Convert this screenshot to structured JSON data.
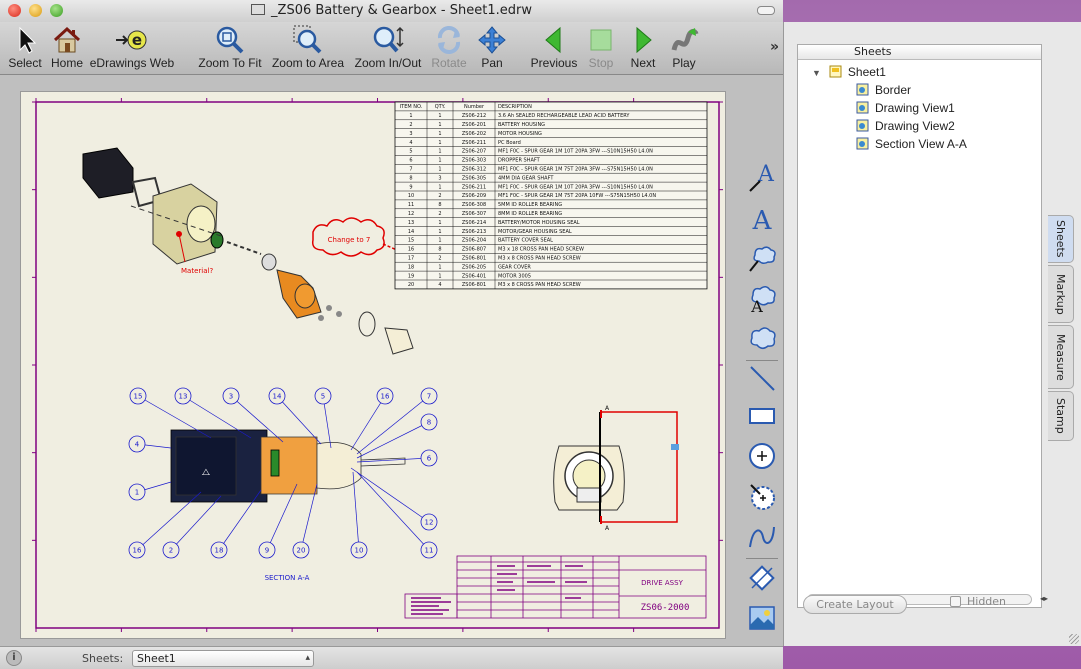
{
  "window": {
    "title": "_ZS06 Battery & Gearbox - Sheet1.edrw"
  },
  "toolbar": {
    "buttons": [
      {
        "id": "select",
        "label": "Select",
        "icon": "cursor-arrow-icon"
      },
      {
        "id": "home",
        "label": "Home",
        "icon": "home-icon"
      },
      {
        "id": "edrawings-web",
        "label": "eDrawings Web",
        "icon": "edrawings-web-icon"
      },
      {
        "id": "zoom-to-fit",
        "label": "Zoom To Fit",
        "icon": "zoom-fit-icon"
      },
      {
        "id": "zoom-to-area",
        "label": "Zoom to Area",
        "icon": "zoom-area-icon"
      },
      {
        "id": "zoom-in-out",
        "label": "Zoom In/Out",
        "icon": "zoom-in-out-icon"
      },
      {
        "id": "rotate",
        "label": "Rotate",
        "icon": "rotate-icon",
        "disabled": true
      },
      {
        "id": "pan",
        "label": "Pan",
        "icon": "pan-icon"
      },
      {
        "id": "previous",
        "label": "Previous",
        "icon": "previous-icon"
      },
      {
        "id": "stop",
        "label": "Stop",
        "icon": "stop-icon",
        "disabled": true
      },
      {
        "id": "next",
        "label": "Next",
        "icon": "next-icon"
      },
      {
        "id": "play",
        "label": "Play",
        "icon": "play-icon"
      }
    ],
    "overflow": "»"
  },
  "drawing": {
    "bom_headers": [
      "ITEM NO.",
      "QTY.",
      "Number",
      "DESCRIPTION"
    ],
    "bom_rows": [
      [
        "1",
        "1",
        "ZS06-212",
        "3.6 Ah SEALED RECHARGEABLE LEAD ACID BATTERY"
      ],
      [
        "2",
        "1",
        "ZS06-201",
        "BATTERY HOUSING"
      ],
      [
        "3",
        "1",
        "ZS06-202",
        "MOTOR HOUSING"
      ],
      [
        "4",
        "1",
        "ZS06-211",
        "PC Board"
      ],
      [
        "5",
        "1",
        "ZS06-207",
        "MF1 F0C - SPUR GEAR 1M 10T 20PA 3FW ---S10N15H50 L4.0N"
      ],
      [
        "6",
        "1",
        "ZS06-303",
        "DROPPER SHAFT"
      ],
      [
        "7",
        "1",
        "ZS06-312",
        "MF1 F0C - SPUR GEAR 1M 75T 20PA 3FW ---S75N15H50 L4.0N"
      ],
      [
        "8",
        "3",
        "ZS06-305",
        "4MM DIA GEAR SHAFT"
      ],
      [
        "9",
        "1",
        "ZS06-211",
        "MF1 F0C - SPUR GEAR 1M 10T 20PA 3FW ---S10N15H50 L4.0N"
      ],
      [
        "10",
        "2",
        "ZS06-209",
        "MF1 F0C - SPUR GEAR 1M 75T 20PA 10FW ---S75N15H50 L4.0N"
      ],
      [
        "11",
        "8",
        "ZS06-308",
        "5MM ID ROLLER BEARING"
      ],
      [
        "12",
        "2",
        "ZS06-307",
        "8MM ID ROLLER BEARING"
      ],
      [
        "13",
        "1",
        "ZS06-214",
        "BATTERY/MOTOR HOUSING SEAL"
      ],
      [
        "14",
        "1",
        "ZS06-213",
        "MOTOR/GEAR HOUSING SEAL"
      ],
      [
        "15",
        "1",
        "ZS06-204",
        "BATTERY COVER SEAL"
      ],
      [
        "16",
        "8",
        "ZS06-807",
        "M3 x 18 CROSS PAN HEAD SCREW"
      ],
      [
        "17",
        "2",
        "ZS06-801",
        "M3 x 8 CROSS PAN HEAD SCREW"
      ],
      [
        "18",
        "1",
        "ZS06-205",
        "GEAR COVER"
      ],
      [
        "19",
        "1",
        "ZS06-401",
        "MOTOR 3005"
      ],
      [
        "20",
        "4",
        "ZS06-801",
        "M3 x 8 CROSS PAN HEAD SCREW"
      ]
    ],
    "markup_change": "Change to 7",
    "markup_material": "Material?",
    "section_label": "SECTION A-A",
    "section_letter": "A",
    "balloons": [
      "15",
      "13",
      "3",
      "14",
      "5",
      "16",
      "7",
      "4",
      "8",
      "6",
      "1",
      "12",
      "16",
      "2",
      "18",
      "9",
      "20",
      "10",
      "11"
    ],
    "title_block_name": "DRIVE ASSY",
    "title_block_number": "ZS06-2000"
  },
  "side_tools": [
    "text-leader-icon",
    "text-icon",
    "cloud-leader-icon",
    "cloud-text-icon",
    "cloud-icon",
    "line-icon",
    "rectangle-icon",
    "circle-plus-icon",
    "circle-leader-icon",
    "spline-icon",
    "dimension-icon",
    "image-icon"
  ],
  "statusbar": {
    "info": "i",
    "sheets_label": "Sheets:",
    "sheets_value": "Sheet1"
  },
  "drawer": {
    "panel_header": "Sheets",
    "tree": [
      {
        "label": "Sheet1",
        "level": 0,
        "expanded": true,
        "type": "sheet"
      },
      {
        "label": "Border",
        "level": 1,
        "type": "view"
      },
      {
        "label": "Drawing View1",
        "level": 1,
        "type": "view"
      },
      {
        "label": "Drawing View2",
        "level": 1,
        "type": "view"
      },
      {
        "label": "Section View A-A",
        "level": 1,
        "type": "view"
      }
    ],
    "create_layout_label": "Create Layout",
    "hidden_label": "Hidden",
    "tabs": [
      "Sheets",
      "Markup",
      "Measure",
      "Stamp"
    ]
  },
  "colors": {
    "accent_blue": "#3a74c9",
    "drawing_border": "#800080",
    "markup_red": "#e00000",
    "balloon_blue": "#1a1acc"
  }
}
